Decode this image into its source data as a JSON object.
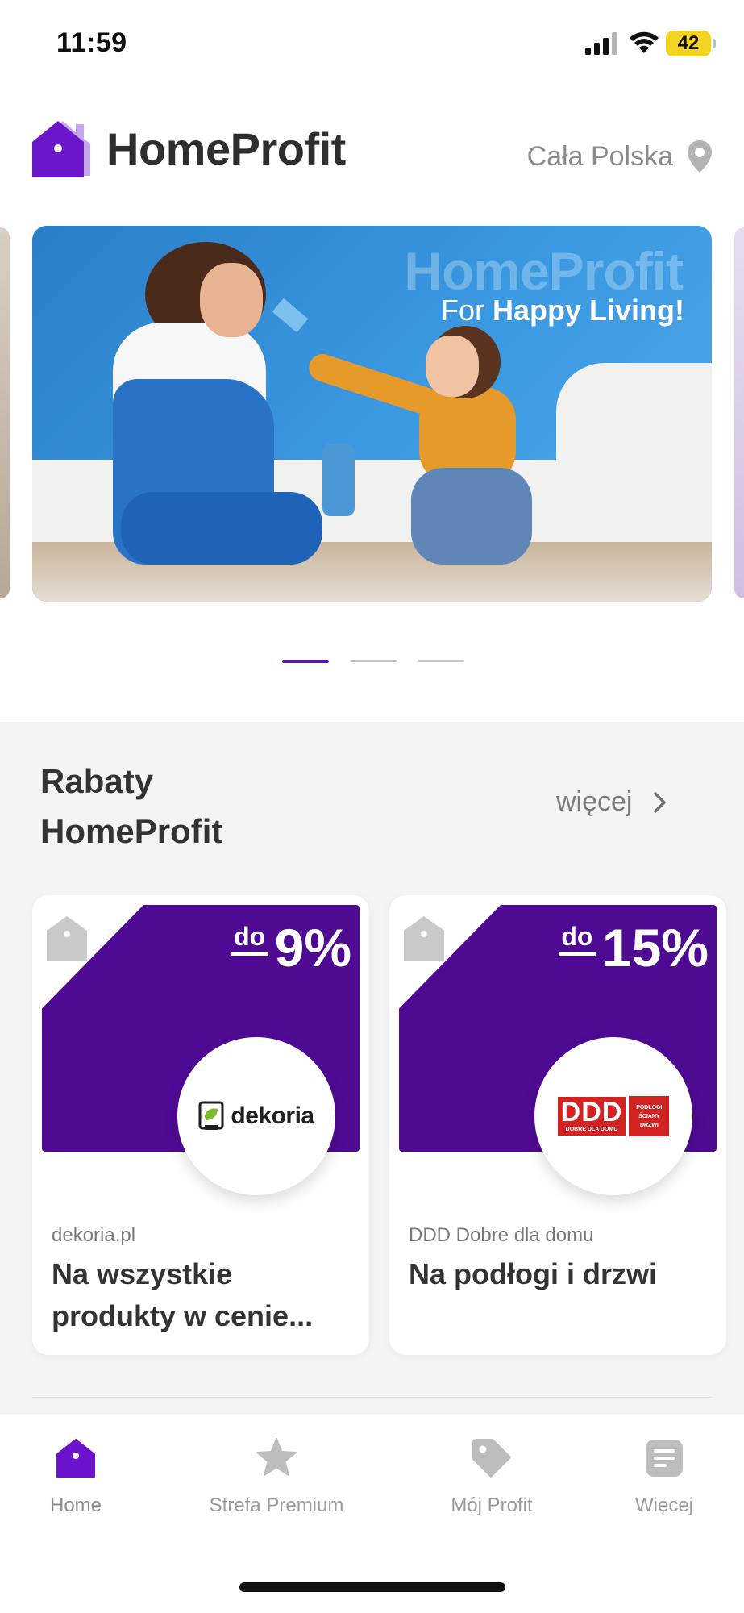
{
  "status_bar": {
    "time": "11:59",
    "battery": "42"
  },
  "header": {
    "logo_text": "HomeProfit",
    "location": "Cała Polska"
  },
  "banner": {
    "brand": "HomeProfit",
    "tagline_prefix": "For ",
    "tagline_bold": "Happy Living!"
  },
  "section": {
    "title": "Rabaty HomeProfit",
    "more_label": "więcej"
  },
  "cards": [
    {
      "prefix": "do",
      "discount": "9%",
      "logo": "dekoria",
      "store": "dekoria.pl",
      "description": "Na wszystkie produkty w cenie..."
    },
    {
      "prefix": "do",
      "discount": "15%",
      "logo_main": "DDD",
      "logo_sub": "DOBRE DLA DOMU",
      "logo_side": "PODŁOGI ŚCIANY DRZWI",
      "store": "DDD Dobre dla domu",
      "description": "Na podłogi i drzwi"
    }
  ],
  "tabs": [
    {
      "label": "Home",
      "icon": "home-icon",
      "active": true
    },
    {
      "label": "Strefa Premium",
      "icon": "star-icon"
    },
    {
      "label": "Mój Profit",
      "icon": "tag-icon"
    },
    {
      "label": "Więcej",
      "icon": "list-icon"
    }
  ],
  "colors": {
    "accent": "#5a0fa8",
    "card_purple": "#4f0a94",
    "battery": "#f3d322"
  }
}
